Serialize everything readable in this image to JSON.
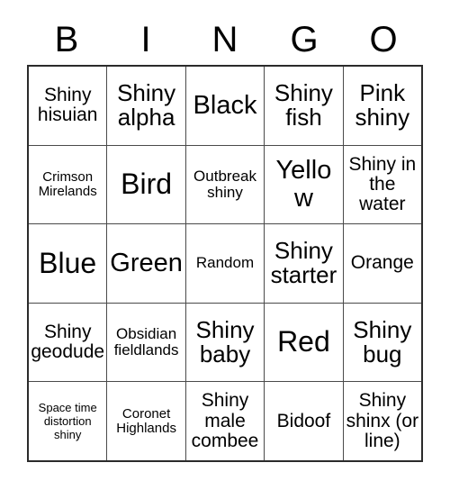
{
  "card": {
    "title": "BINGO",
    "header_letters": [
      "B",
      "I",
      "N",
      "G",
      "O"
    ],
    "accent_color": "#000000",
    "border_color": "#2b2b2b",
    "grid_line_color": "#4a4a4a",
    "background_color": "#ffffff",
    "rows": [
      [
        {
          "text": "Shiny hisuian",
          "size": "md"
        },
        {
          "text": "Shiny alpha",
          "size": "lg"
        },
        {
          "text": "Black",
          "size": "xl"
        },
        {
          "text": "Shiny fish",
          "size": "lg"
        },
        {
          "text": "Pink shiny",
          "size": "lg"
        }
      ],
      [
        {
          "text": "Crimson Mirelands",
          "size": "xs"
        },
        {
          "text": "Bird",
          "size": "xxl"
        },
        {
          "text": "Outbreak shiny",
          "size": "sm"
        },
        {
          "text": "Yellow",
          "size": "xl"
        },
        {
          "text": "Shiny in the water",
          "size": "md"
        }
      ],
      [
        {
          "text": "Blue",
          "size": "xxl"
        },
        {
          "text": "Green",
          "size": "xl"
        },
        {
          "text": "Random",
          "size": "sm"
        },
        {
          "text": "Shiny starter",
          "size": "lg"
        },
        {
          "text": "Orange",
          "size": "md"
        }
      ],
      [
        {
          "text": "Shiny geodude",
          "size": "md"
        },
        {
          "text": "Obsidian fieldlands",
          "size": "sm"
        },
        {
          "text": "Shiny baby",
          "size": "lg"
        },
        {
          "text": "Red",
          "size": "xxl"
        },
        {
          "text": "Shiny bug",
          "size": "lg"
        }
      ],
      [
        {
          "text": "Space time distortion shiny",
          "size": "xxs"
        },
        {
          "text": "Coronet Highlands",
          "size": "xs"
        },
        {
          "text": "Shiny male combee",
          "size": "md"
        },
        {
          "text": "Bidoof",
          "size": "md"
        },
        {
          "text": "Shiny shinx (or line)",
          "size": "md"
        }
      ]
    ]
  }
}
